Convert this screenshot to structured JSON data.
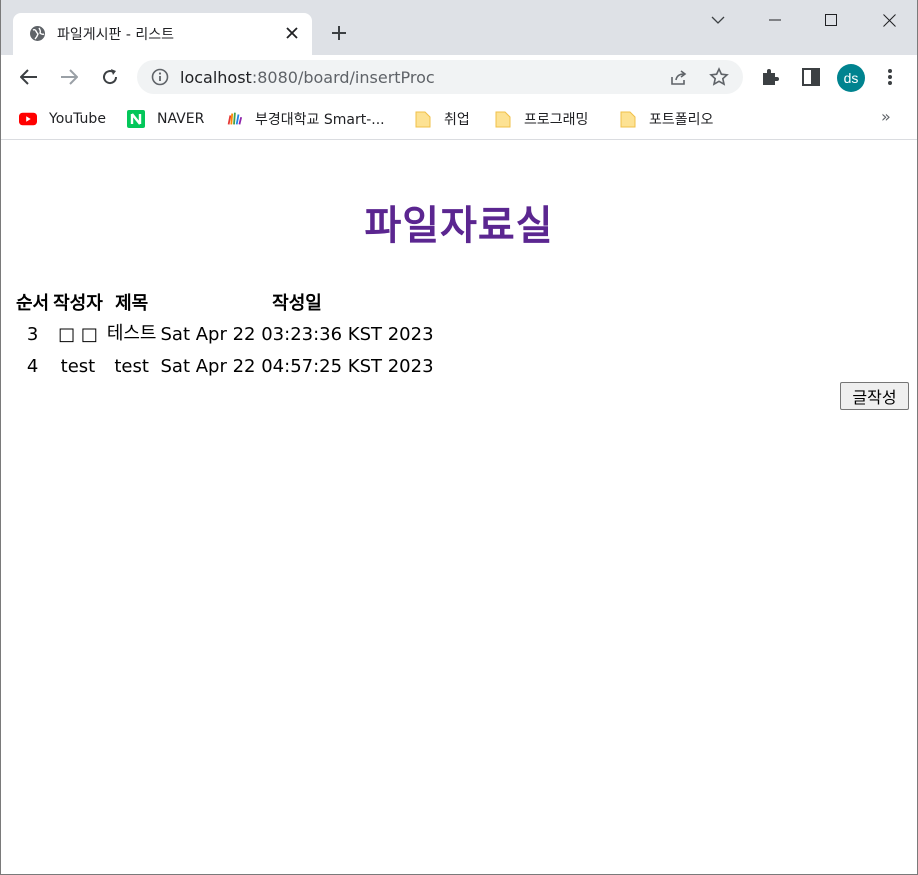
{
  "browser": {
    "tab_title": "파일게시판 - 리스트",
    "url_host": "localhost",
    "url_rest": ":8080/board/insertProc",
    "profile_initials": "ds",
    "bookmarks": [
      {
        "label": "YouTube",
        "icon": "youtube-icon"
      },
      {
        "label": "NAVER",
        "icon": "naver-icon"
      },
      {
        "label": "부경대학교 Smart-...",
        "icon": "pknu-icon"
      },
      {
        "label": "취업",
        "icon": "folder-icon"
      },
      {
        "label": "프로그래밍",
        "icon": "folder-icon"
      },
      {
        "label": "포트폴리오",
        "icon": "folder-icon"
      }
    ],
    "bookmarks_more": "»"
  },
  "page": {
    "heading": "파일자료실",
    "table": {
      "headers": [
        "순서",
        "작성자",
        "제목",
        "작성일"
      ],
      "rows": [
        {
          "no": "3",
          "writer": "□ □",
          "title": "테스트",
          "date": "Sat Apr 22 03:23:36 KST 2023"
        },
        {
          "no": "4",
          "writer": "test",
          "title": "test",
          "date": "Sat Apr 22 04:57:25 KST 2023"
        }
      ]
    },
    "write_button": "글작성"
  },
  "colors": {
    "heading": "#5b2690",
    "tabstrip": "#dee1e6",
    "avatar": "#00838f"
  }
}
